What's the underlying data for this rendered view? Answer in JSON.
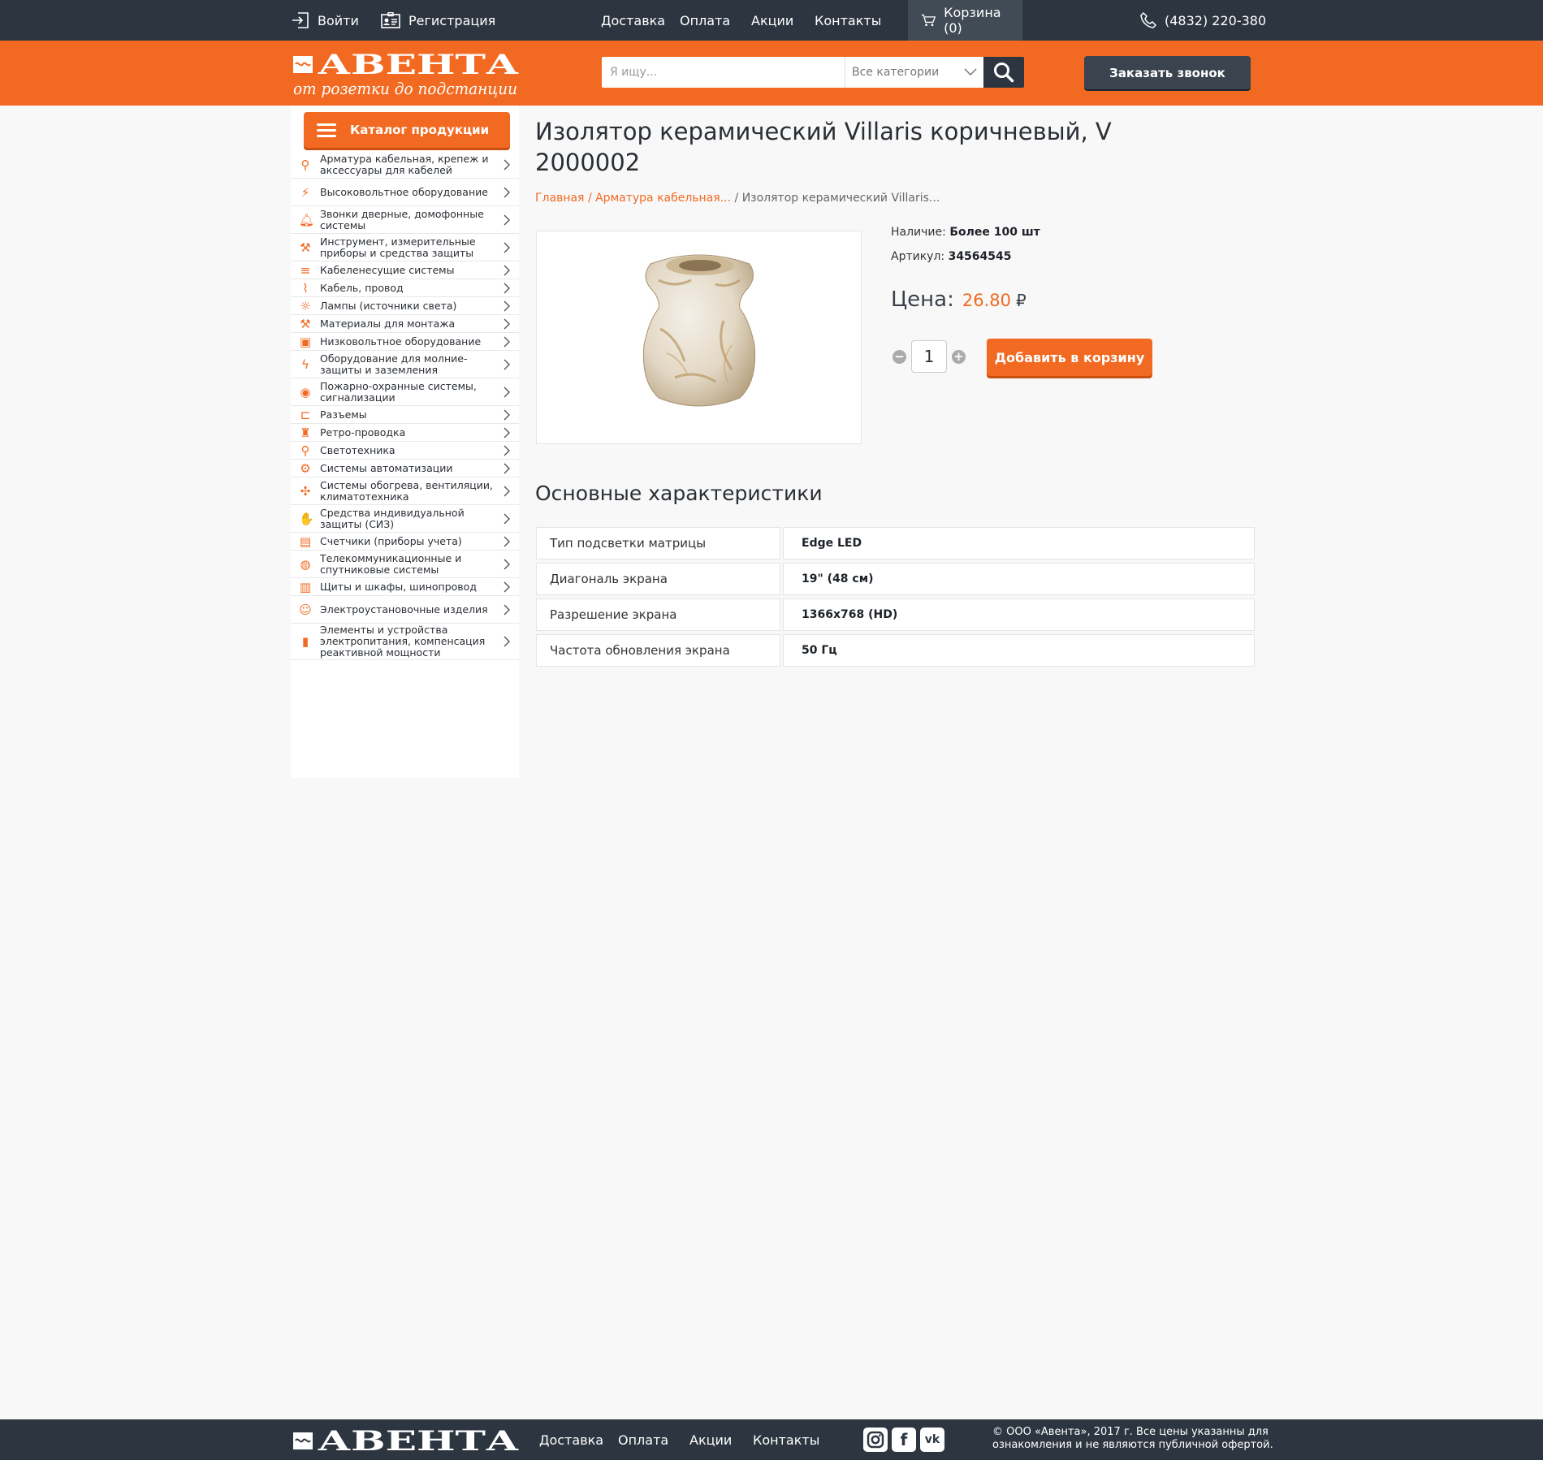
{
  "topbar": {
    "login": "Войти",
    "register": "Регистрация",
    "nav": [
      "Доставка",
      "Оплата",
      "Акции",
      "Контакты"
    ],
    "cart": "Корзина (0)",
    "phone": "(4832) 220-380"
  },
  "header": {
    "logo_text": "АВЕНТА",
    "logo_slogan": "от розетки до подстанции",
    "search_placeholder": "Я ищу...",
    "category_select": "Все категории",
    "callback_button": "Заказать звонок"
  },
  "sidebar": {
    "catalog_button": "Каталог продукции",
    "items": [
      {
        "label": "Арматура кабельная, крепеж и аксессуары для кабелей",
        "icon": "cable-fitting-icon"
      },
      {
        "label": "Высоковольтное оборудование",
        "icon": "power-tower-icon"
      },
      {
        "label": "Звонки дверные, домофонные системы",
        "icon": "bell-icon"
      },
      {
        "label": "Инструмент, измерительные приборы и средства защиты",
        "icon": "wrench-icon"
      },
      {
        "label": "Кабеленесущие системы",
        "icon": "cable-tray-icon"
      },
      {
        "label": "Кабель, провод",
        "icon": "cable-icon"
      },
      {
        "label": "Лампы (источники света)",
        "icon": "lightbulb-icon"
      },
      {
        "label": "Материалы для монтажа",
        "icon": "hammer-icon"
      },
      {
        "label": "Низковольтное оборудование",
        "icon": "breaker-icon"
      },
      {
        "label": "Оборудование для молние-защиты и заземления",
        "icon": "lightning-icon"
      },
      {
        "label": "Пожарно-охранные системы, сигнализации",
        "icon": "camera-icon"
      },
      {
        "label": "Разъемы",
        "icon": "connector-icon"
      },
      {
        "label": "Ретро-проводка",
        "icon": "retro-insulator-icon"
      },
      {
        "label": "Светотехника",
        "icon": "desk-lamp-icon"
      },
      {
        "label": "Системы автоматизации",
        "icon": "automation-icon"
      },
      {
        "label": "Системы обогрева, вентиляции, климатотехника",
        "icon": "fan-icon"
      },
      {
        "label": "Средства индивидуальной защиты (СИЗ)",
        "icon": "glove-icon"
      },
      {
        "label": "Счетчики (приборы учета)",
        "icon": "meter-icon"
      },
      {
        "label": "Телекоммуникационные и спутниковые системы",
        "icon": "satellite-icon"
      },
      {
        "label": "Щиты и шкафы, шинопровод",
        "icon": "cabinet-icon"
      },
      {
        "label": "Электроустановочные изделия",
        "icon": "socket-icon"
      },
      {
        "label": "Элементы и устройства электропитания, компенсация реактивной мощности",
        "icon": "battery-icon"
      }
    ]
  },
  "product": {
    "title": "Изолятор керамический Villaris коричневый, V 2000002",
    "breadcrumb": {
      "home": "Главная",
      "category": "Арматура кабельная...",
      "separator": "/",
      "current": "Изолятор керамический Villaris..."
    },
    "availability_label": "Наличие:",
    "availability_value": "Более 100 шт",
    "article_label": "Артикул:",
    "article_value": "34564545",
    "price_label": "Цена:",
    "price_value": "26.80",
    "currency": "₽",
    "quantity": "1",
    "add_to_cart": "Добавить в корзину"
  },
  "specs": {
    "heading": "Основные характеристики",
    "rows": [
      {
        "key": "Тип подсветки матрицы",
        "value": "Edge LED"
      },
      {
        "key": "Диагональ экрана",
        "value": "19\" (48 см)"
      },
      {
        "key": "Разрешение экрана",
        "value": "1366x768 (HD)"
      },
      {
        "key": "Частота обновления экрана",
        "value": "50 Гц"
      }
    ]
  },
  "footer": {
    "logo_text": "АВЕНТА",
    "nav": [
      "Доставка",
      "Оплата",
      "Акции",
      "Контакты"
    ],
    "social": [
      "instagram-icon",
      "facebook-icon",
      "vk-icon"
    ],
    "copyright": "© ООО «Авента», 2017 г. Все цены указанны  для ознакомления и не являются публичной офертой."
  },
  "colors": {
    "accent": "#f26a22",
    "dark": "#2d3640",
    "background": "#f8f8f8"
  }
}
